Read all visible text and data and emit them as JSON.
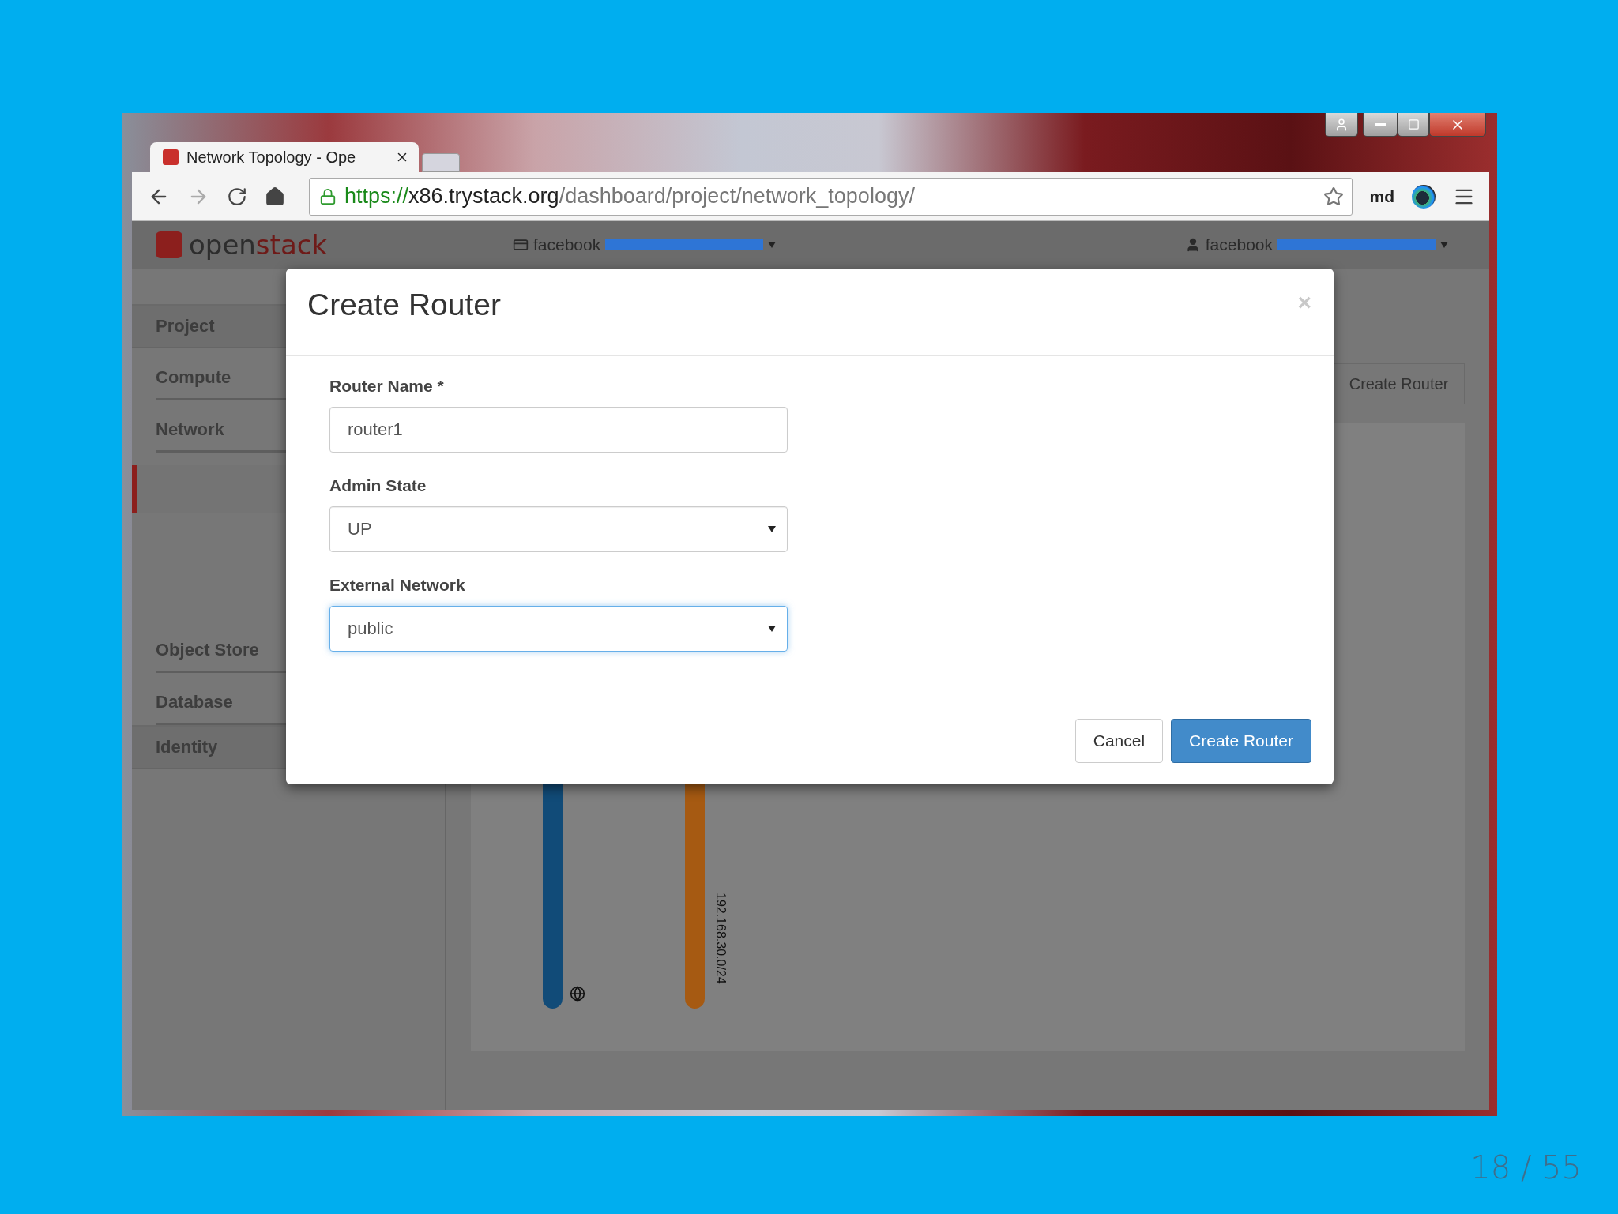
{
  "browser": {
    "tab": {
      "title": "Network Topology - Ope",
      "selected": true
    },
    "url": {
      "scheme": "https://",
      "host": "x86.trystack.org",
      "path": "/dashboard/project/network_topology/"
    },
    "extension_label": "md"
  },
  "header": {
    "logo": {
      "prefix": "open",
      "suffix": "stack"
    },
    "project": "facebook",
    "user": "facebook"
  },
  "sidebar": {
    "items": [
      {
        "label": "Project",
        "kind": "panel",
        "selected": false
      },
      {
        "label": "Compute",
        "kind": "group",
        "selected": false
      },
      {
        "label": "Network",
        "kind": "group",
        "selected": false
      },
      {
        "kind": "subitem",
        "selected": true
      },
      {
        "label": "Object Store",
        "kind": "group",
        "selected": false
      },
      {
        "label": "Database",
        "kind": "group",
        "selected": false
      },
      {
        "label": "Identity",
        "kind": "panel",
        "selected": false
      }
    ]
  },
  "main": {
    "action_button": "Create Router",
    "networks": [
      {
        "kind": "external",
        "color": "#114b78"
      },
      {
        "kind": "internal",
        "color": "#a65a12",
        "label": "192.168.30.0/24"
      }
    ]
  },
  "dialog": {
    "title": "Create Router",
    "close_symbol": "×",
    "fields": [
      {
        "label": "Router Name",
        "required_mark": "*",
        "kind": "text",
        "value": "router1",
        "focused": false
      },
      {
        "label": "Admin State",
        "kind": "select",
        "value": "UP",
        "focused": false
      },
      {
        "label": "External Network",
        "kind": "select",
        "value": "public",
        "focused": true
      }
    ],
    "buttons": [
      {
        "label": "Cancel",
        "kind": "default"
      },
      {
        "label": "Create Router",
        "kind": "primary"
      }
    ]
  },
  "slide": {
    "page_number": "18 / 55"
  }
}
